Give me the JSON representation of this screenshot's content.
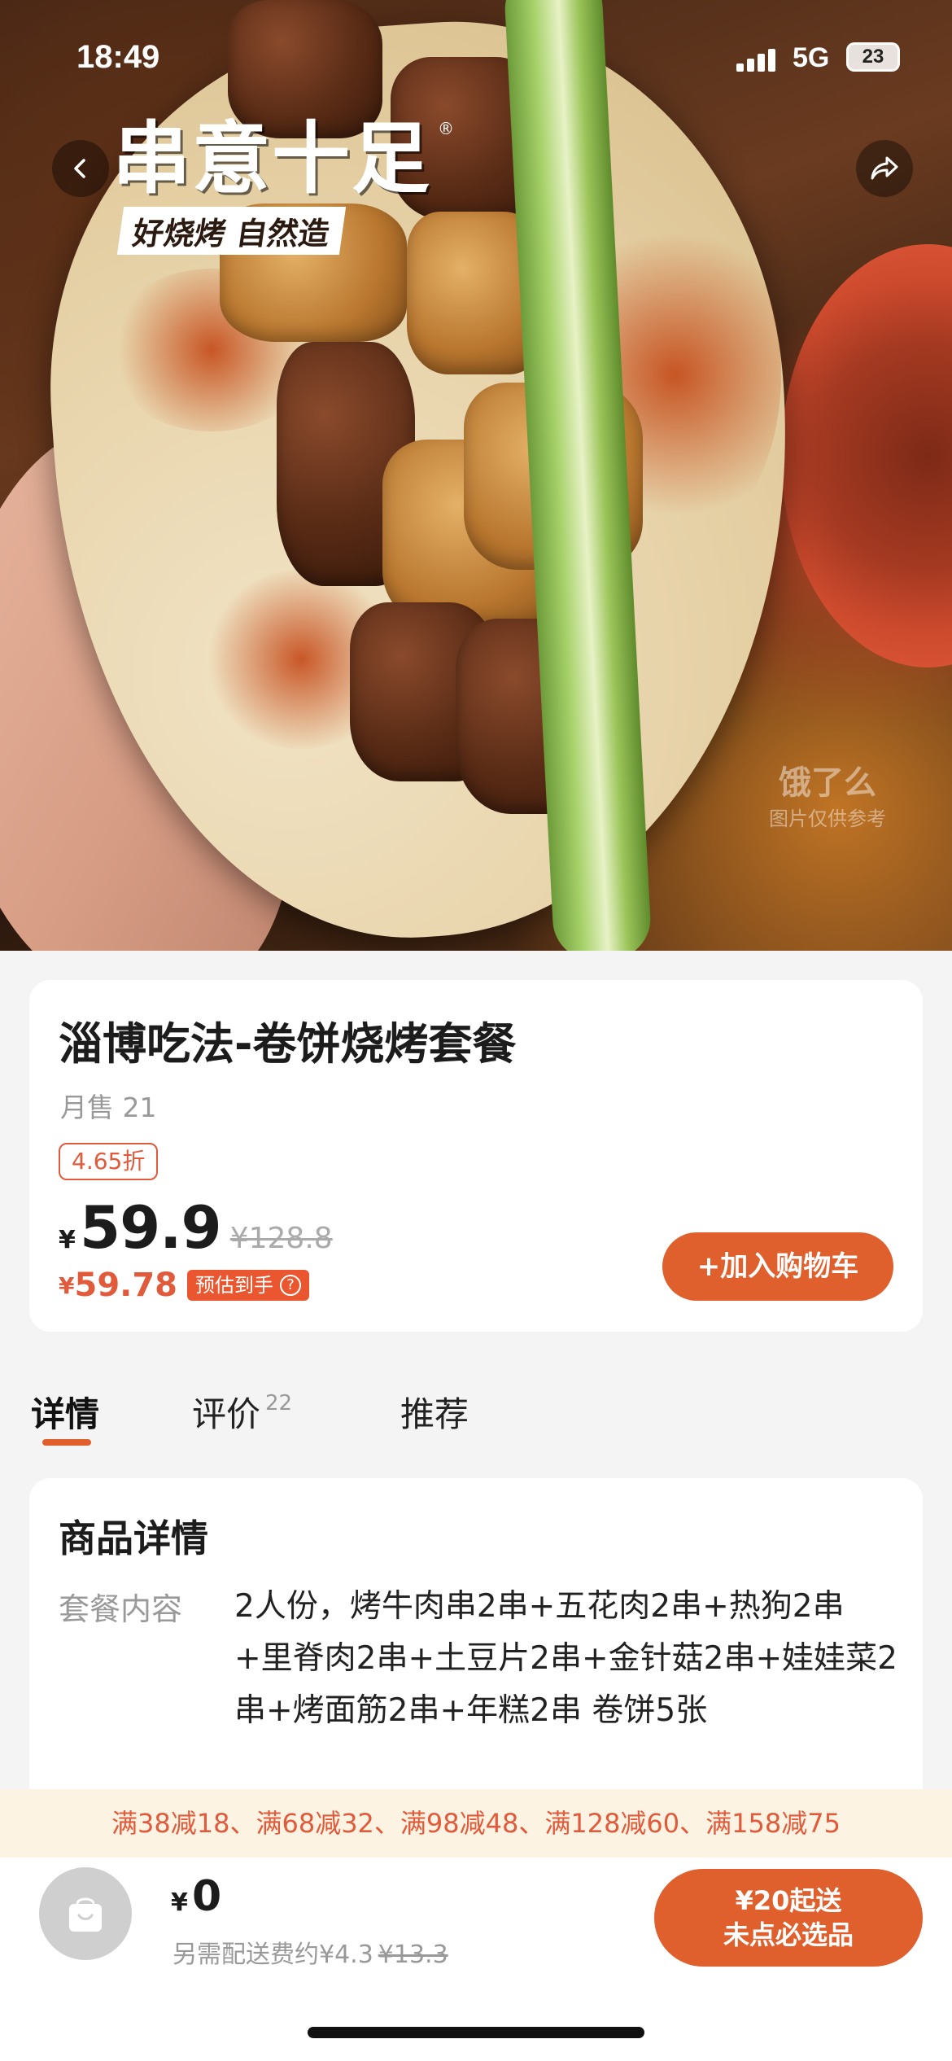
{
  "status_bar": {
    "time": "18:49",
    "network": "5G",
    "battery": "23"
  },
  "hero": {
    "logo_main": "串意十足",
    "logo_registered": "®",
    "logo_tagline": "好烧烤 自然造",
    "watermark_brand": "饿了么",
    "watermark_note": "图片仅供参考"
  },
  "product": {
    "title": "淄博吃法-卷饼烧烤套餐",
    "monthly_sales": "月售 21",
    "discount": "4.65折",
    "currency": "¥",
    "price": "59.9",
    "original_price": "¥128.8",
    "estimated_price": "59.78",
    "estimated_label": "预估到手",
    "estimated_help_icon": "?",
    "add_to_cart": "+加入购物车"
  },
  "tabs": [
    {
      "label": "详情"
    },
    {
      "label": "评价",
      "count": "22"
    },
    {
      "label": "推荐"
    }
  ],
  "details": {
    "section_title": "商品详情",
    "package_label": "套餐内容",
    "package_value": "2人份，烤牛肉串2串+五花肉2串+热狗2串+里脊肉2串+土豆片2串+金针菇2串+娃娃菜2串+烤面筋2串+年糕2串 卷饼5张"
  },
  "promo": {
    "text": "满38减18、满68减32、满98减48、满128减60、满158减75"
  },
  "bottom": {
    "currency": "¥",
    "total": "0",
    "delivery_label": "另需配送费约¥4.3",
    "delivery_original": "¥13.3",
    "checkout_line1": "¥20起送",
    "checkout_line2": "未点必选品"
  },
  "colors": {
    "accent": "#e0602d",
    "promo_text": "#e05a3b",
    "promo_bg": "#fdf3e2",
    "page_bg": "#f4f4f4"
  }
}
